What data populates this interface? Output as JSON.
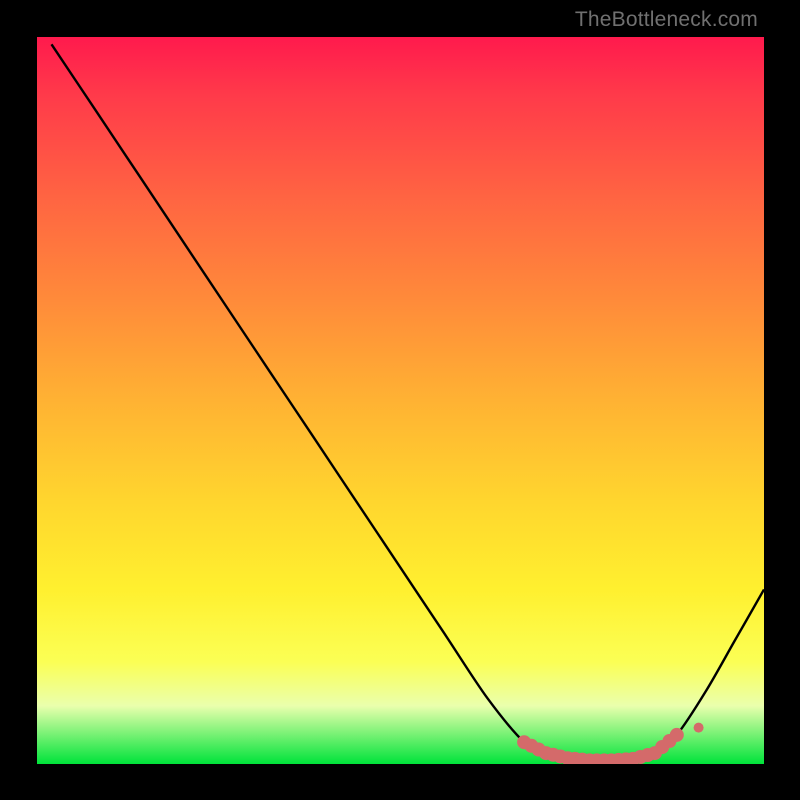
{
  "watermark": "TheBottleneck.com",
  "chart_data": {
    "type": "line",
    "title": "",
    "xlabel": "",
    "ylabel": "",
    "xlim": [
      0,
      100
    ],
    "ylim": [
      0,
      100
    ],
    "x": [
      2,
      8,
      14,
      20,
      26,
      32,
      38,
      44,
      50,
      56,
      62,
      67,
      70,
      73,
      76,
      79,
      82,
      85,
      88,
      92,
      96,
      100
    ],
    "values": [
      99,
      90,
      81,
      72,
      63,
      54,
      45,
      36,
      27,
      18,
      9,
      3,
      1.5,
      0.8,
      0.5,
      0.5,
      0.7,
      1.5,
      4,
      10,
      17,
      24
    ],
    "marker_points_x": [
      67,
      70,
      73,
      76,
      79,
      82,
      85,
      88
    ],
    "marker_points_y": [
      3,
      1.5,
      0.8,
      0.5,
      0.5,
      0.7,
      1.5,
      4
    ],
    "marker_color": "#d46a6a",
    "line_color": "#000000"
  }
}
